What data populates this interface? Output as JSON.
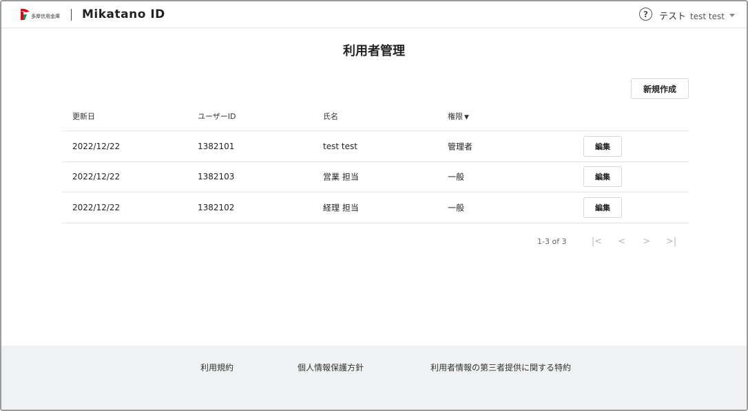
{
  "header": {
    "bank_name": "多摩信用金庫",
    "brand": "Mikatano ID",
    "user_name": "テスト",
    "user_id": "test test"
  },
  "page": {
    "title": "利用者管理",
    "create_label": "新規作成"
  },
  "table": {
    "headers": {
      "updated": "更新日",
      "user_id": "ユーザーID",
      "name": "氏名",
      "role": "権限",
      "role_sort": "▼"
    },
    "rows": [
      {
        "updated": "2022/12/22",
        "user_id": "1382101",
        "name": "test test",
        "role": "管理者",
        "edit": "編集"
      },
      {
        "updated": "2022/12/22",
        "user_id": "1382103",
        "name": "営業 担当",
        "role": "一般",
        "edit": "編集"
      },
      {
        "updated": "2022/12/22",
        "user_id": "1382102",
        "name": "経理 担当",
        "role": "一般",
        "edit": "編集"
      }
    ]
  },
  "pagination": {
    "range": "1-3 of 3",
    "first": "|<",
    "prev": "<",
    "next": ">",
    "last": ">|"
  },
  "footer": {
    "terms": "利用規約",
    "privacy": "個人情報保護方針",
    "third_party": "利用者情報の第三者提供に関する特約"
  },
  "colors": {
    "logo_red": "#e60012",
    "logo_green": "#009b63",
    "footer_bg": "#eff1f2"
  },
  "icons": {
    "help": "help-circle-icon",
    "dropdown": "caret-down-icon"
  }
}
